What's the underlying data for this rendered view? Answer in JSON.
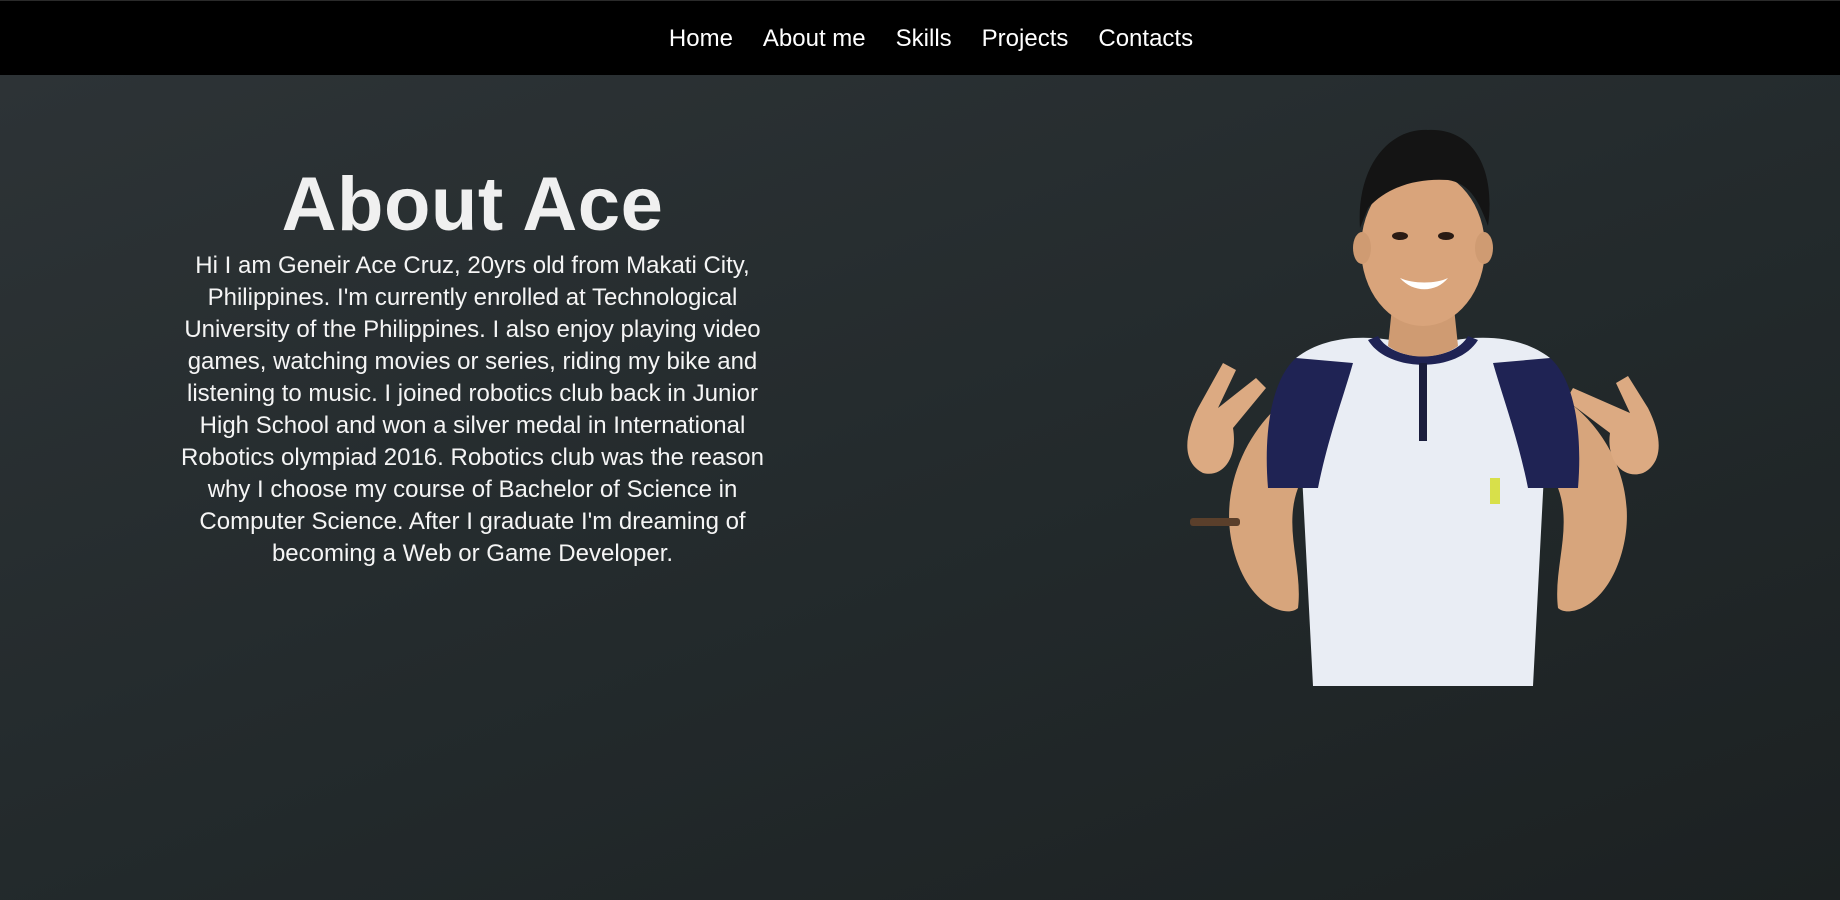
{
  "nav": {
    "items": [
      {
        "label": "Home"
      },
      {
        "label": "About me"
      },
      {
        "label": "Skills"
      },
      {
        "label": "Projects"
      },
      {
        "label": "Contacts"
      }
    ]
  },
  "about": {
    "title": "About Ace",
    "bio": "Hi I am Geneir Ace Cruz, 20yrs old from Makati City, Philippines. I'm currently enrolled at Technological University of the Philippines. I also enjoy playing video games, watching movies or series, riding my bike and listening to music. I joined robotics club back in Junior High School and won a silver medal in International Robotics olympiad 2016. Robotics club was the reason why I choose my course of Bachelor of Science in Computer Science. After I graduate I'm dreaming of becoming a Web or Game Developer."
  },
  "photo": {
    "alt": "profile-photo"
  },
  "colors": {
    "navbar": "#000000",
    "background": "#272e30",
    "text": "#f2f2f2"
  }
}
